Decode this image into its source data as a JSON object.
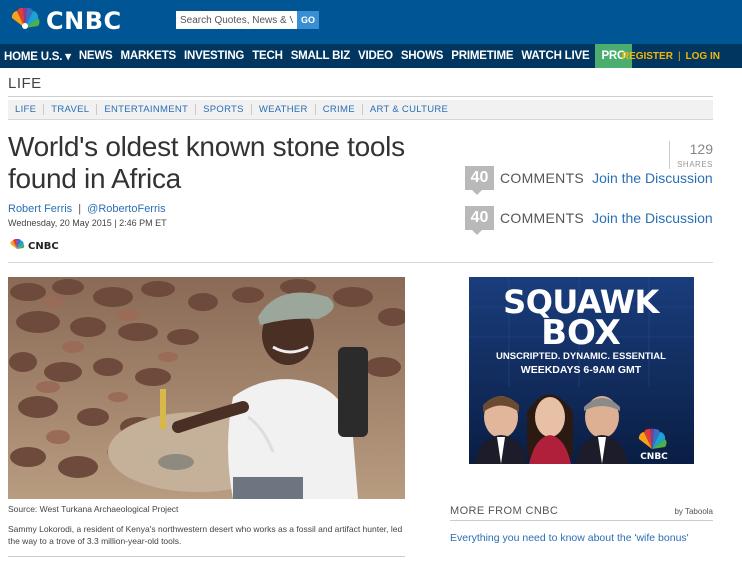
{
  "header": {
    "brand": "CNBC",
    "search": {
      "placeholder": "Search Quotes, News & V",
      "go_label": "GO"
    }
  },
  "nav": {
    "items": [
      {
        "label": "HOME U.S. ▾"
      },
      {
        "label": "NEWS"
      },
      {
        "label": "MARKETS"
      },
      {
        "label": "INVESTING"
      },
      {
        "label": "TECH"
      },
      {
        "label": "SMALL BIZ"
      },
      {
        "label": "VIDEO"
      },
      {
        "label": "SHOWS"
      },
      {
        "label": "PRIMETIME"
      },
      {
        "label": "WATCH LIVE"
      },
      {
        "label": "PRO"
      }
    ],
    "register": "REGISTER",
    "login": "LOG IN",
    "separator": "|"
  },
  "section": {
    "title": "LIFE",
    "subnav": [
      "LIFE",
      "TRAVEL",
      "ENTERTAINMENT",
      "SPORTS",
      "WEATHER",
      "CRIME",
      "ART & CULTURE"
    ]
  },
  "article": {
    "headline": "World's oldest known stone tools found in Africa",
    "author": "Robert Ferris",
    "author_handle": "@RobertoFerris",
    "byline_separator": "|",
    "date": "Wednesday, 20 May 2015 | 2:46 PM ET",
    "source_brand": "CNBC",
    "photo_source": "Source: West Turkana Archaeological Project",
    "photo_caption": "Sammy Lokorodi, a resident of Kenya's northwestern desert who works as a fossil and artifact hunter, led the way to a trove of 3.3 million-year-old tools."
  },
  "social": {
    "shares_count": "129",
    "shares_label": "SHARES",
    "comments": [
      {
        "count": "40",
        "label": "COMMENTS",
        "link": "Join the Discussion"
      },
      {
        "count": "40",
        "label": "COMMENTS",
        "link": "Join the Discussion"
      }
    ]
  },
  "ad": {
    "title_line1": "SQUAWK",
    "title_line2": "BOX",
    "tagline": "UNSCRIPTED. DYNAMIC. ESSENTIAL",
    "schedule": "WEEKDAYS 6-9AM GMT",
    "brand": "CNBC"
  },
  "more": {
    "title": "MORE FROM CNBC",
    "by": "by Taboola",
    "items": [
      {
        "label": "Everything you need to know about the 'wife bonus'"
      }
    ]
  },
  "colors": {
    "header_blue": "#005594",
    "nav_navy": "#003660",
    "pro_green": "#4cae6e",
    "link_blue": "#2a6fb5",
    "login_yellow": "#f2b705"
  }
}
